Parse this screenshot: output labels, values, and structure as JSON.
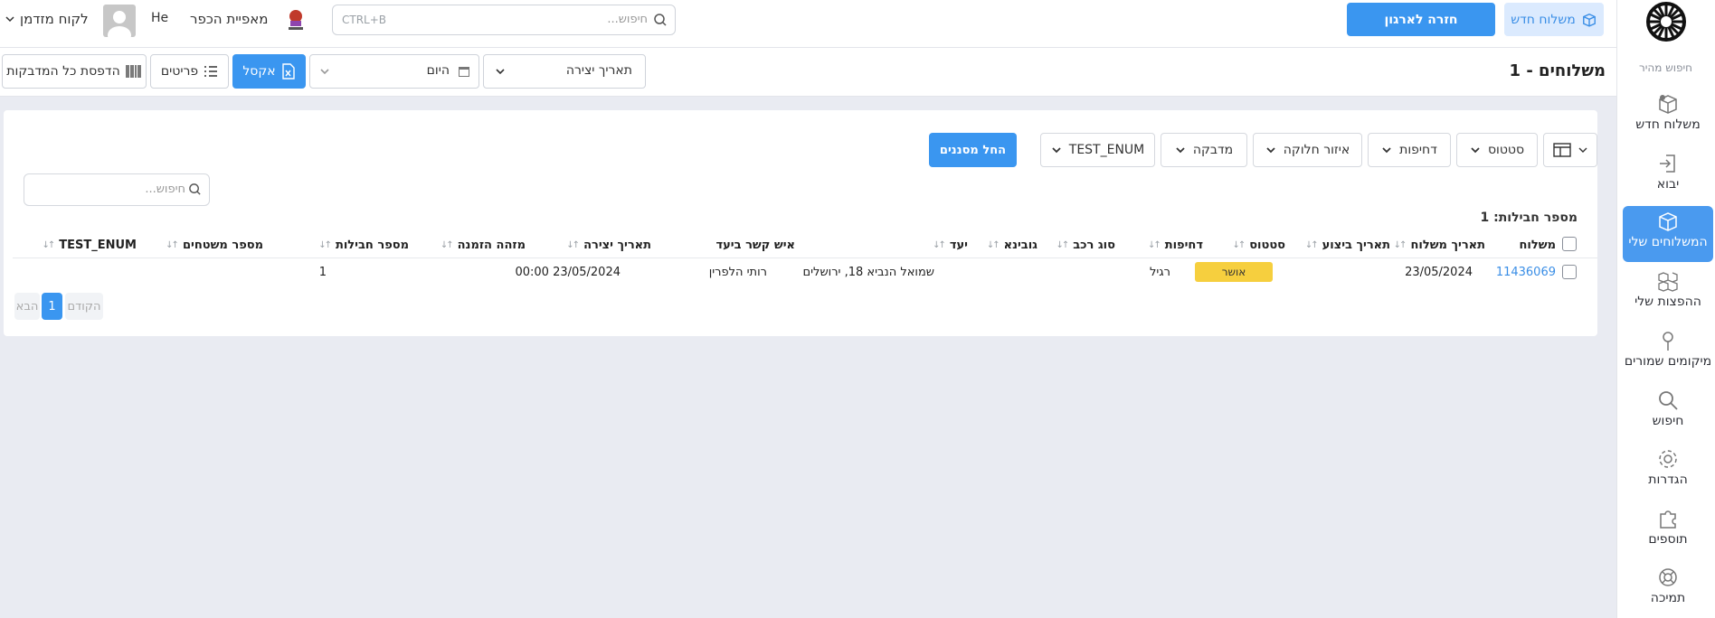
{
  "sidebar": {
    "quick_search": "חיפוש מהיר",
    "items": [
      {
        "label": "משלוח חדש",
        "icon": "box-plus-icon"
      },
      {
        "label": "יבוא",
        "icon": "import-icon"
      },
      {
        "label": "המשלוחים שלי",
        "icon": "box-icon",
        "active": true
      },
      {
        "label": "ההפצות שלי",
        "icon": "boxes-icon"
      },
      {
        "label": "מיקומים שמורים",
        "icon": "pin-icon"
      },
      {
        "label": "חיפוש",
        "icon": "search-icon"
      },
      {
        "label": "הגדרות",
        "icon": "gear-icon"
      },
      {
        "label": "תוספים",
        "icon": "puzzle-icon"
      },
      {
        "label": "תמיכה",
        "icon": "lifebuoy-icon"
      }
    ]
  },
  "topbar": {
    "new_shipment": "משלוח חדש",
    "back_to_org": "חזרה לארגון",
    "search_placeholder": "חיפוש...",
    "search_shortcut": "CTRL+B",
    "business_name": "מאפיית הכפר",
    "language": "He",
    "user": "לקוח מזדמן"
  },
  "title_bar": {
    "title": "משלוחים - 1",
    "date_field": "תאריך יצירה",
    "date_range": "היום",
    "excel": "אקסל",
    "details": "פריטים",
    "print_all": "הדפסת כל המדבקות"
  },
  "filters": {
    "status": "סטטוס",
    "urgency": "דחיפות",
    "zone": "איזור חלוקה",
    "sticker": "מדבקה",
    "test_enum": "TEST_ENUM",
    "apply": "החל מסננים"
  },
  "table": {
    "search_placeholder": "חיפוש...",
    "packages_count": "מספר חבילות: 1",
    "columns": [
      "משלוח",
      "תאריך משלוח",
      "תאריך ביצוע",
      "סטטוס",
      "דחיפות",
      "סוג רכב",
      "גובינא",
      "יעד",
      "איש קשר ביעד",
      "תאריך יצירה",
      "מזהה הזמנה",
      "מספר חבילות",
      "מספר משטחים",
      "TEST_ENUM"
    ],
    "rows": [
      {
        "shipment": "11436069",
        "shipment_date": "23/05/2024",
        "execution_date": "",
        "status": "אושר",
        "urgency": "רגיל",
        "vehicle": "",
        "gubina": "",
        "destination": "שמואל הנביא 18, ירושלים",
        "contact": "רותי הלפרין",
        "created": "23/05/2024 00:00",
        "order_id": "",
        "packages": "1",
        "pallets": "",
        "test_enum": ""
      }
    ]
  },
  "pagination": {
    "prev": "הקודם",
    "page": "1",
    "next": "הבא"
  },
  "colors": {
    "primary": "#3a96f0",
    "status_approved": "#f6cf3e",
    "link": "#3a8ee6"
  }
}
